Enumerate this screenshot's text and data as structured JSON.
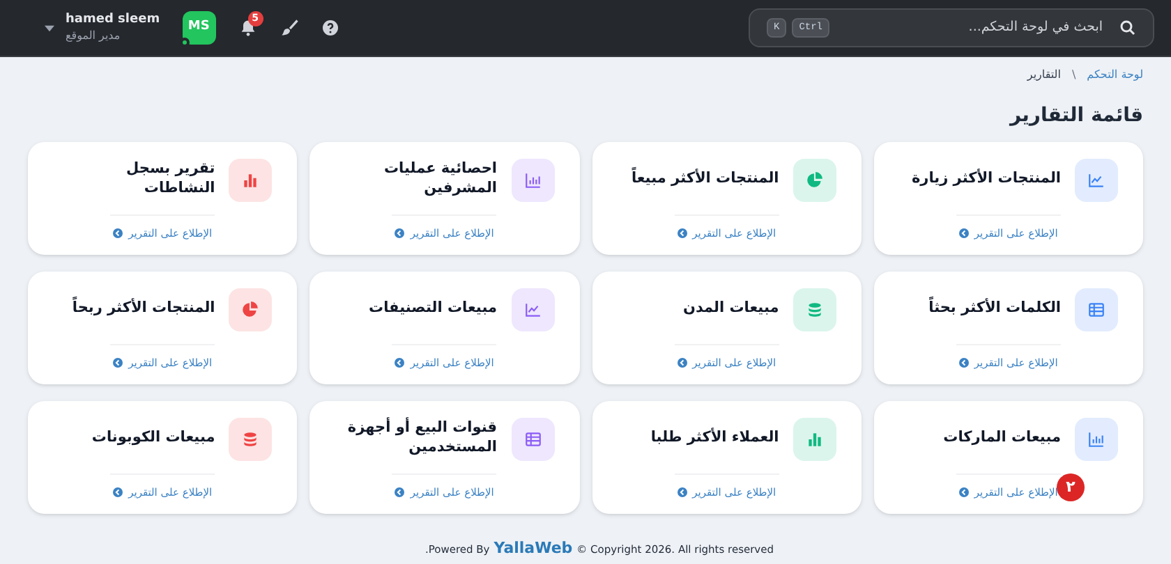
{
  "header": {
    "search": {
      "placeholder": "ابحث في لوحة التحكم...",
      "shortcut": [
        "Ctrl",
        "K"
      ]
    },
    "notifications": {
      "count": "5"
    },
    "user": {
      "initials": "MS",
      "online": true,
      "name": "hamed sleem",
      "role": "مدير الموقع"
    }
  },
  "breadcrumb": [
    {
      "label": "لوحة التحكم"
    },
    {
      "label": "التقارير"
    }
  ],
  "breadcrumb_separator": "\\",
  "page_title": "قائمة التقارير",
  "cards": [
    {
      "title": "المنتجات الأكثر زيارة",
      "kind": "line",
      "color": "#3b82f6",
      "link": "الإطلاع على التقرير"
    },
    {
      "title": "المنتجات الأكثر مبيعاً",
      "kind": "pie",
      "color": "#10b981",
      "link": "الإطلاع على التقرير"
    },
    {
      "title": "احصائية عمليات المشرفين",
      "kind": "barbox",
      "color": "#8b5cf6",
      "link": "الإطلاع على التقرير"
    },
    {
      "title": "تقرير بسجل النشاطات",
      "kind": "bars",
      "color": "#ef4444",
      "link": "الإطلاع على التقرير"
    },
    {
      "title": "الكلمات الأكثر بحثاً",
      "kind": "table",
      "color": "#3b82f6",
      "link": "الإطلاع على التقرير"
    },
    {
      "title": "مبيعات المدن",
      "kind": "coins",
      "color": "#10b981",
      "link": "الإطلاع على التقرير"
    },
    {
      "title": "مبيعات التصنيفات",
      "kind": "line",
      "color": "#8b5cf6",
      "link": "الإطلاع على التقرير"
    },
    {
      "title": "المنتجات الأكثر ربحاً",
      "kind": "pie",
      "color": "#ef4444",
      "link": "الإطلاع على التقرير"
    },
    {
      "title": "مبيعات الماركات",
      "kind": "barbox",
      "color": "#3b82f6",
      "link": "الإطلاع على التقرير",
      "badge": "٢"
    },
    {
      "title": "العملاء الأكثر طلبا",
      "kind": "bars",
      "color": "#10b981",
      "link": "الإطلاع على التقرير"
    },
    {
      "title": "قنوات البيع أو أجهزة المستخدمين",
      "kind": "table",
      "color": "#8b5cf6",
      "link": "الإطلاع على التقرير"
    },
    {
      "title": "مبيعات الكوبونات",
      "kind": "coins",
      "color": "#ef4444",
      "link": "الإطلاع على التقرير"
    }
  ],
  "footer": {
    "prefix": ".Powered By",
    "brand": "YallaWeb",
    "copyright": "© Copyright 2026. All rights reserved"
  }
}
